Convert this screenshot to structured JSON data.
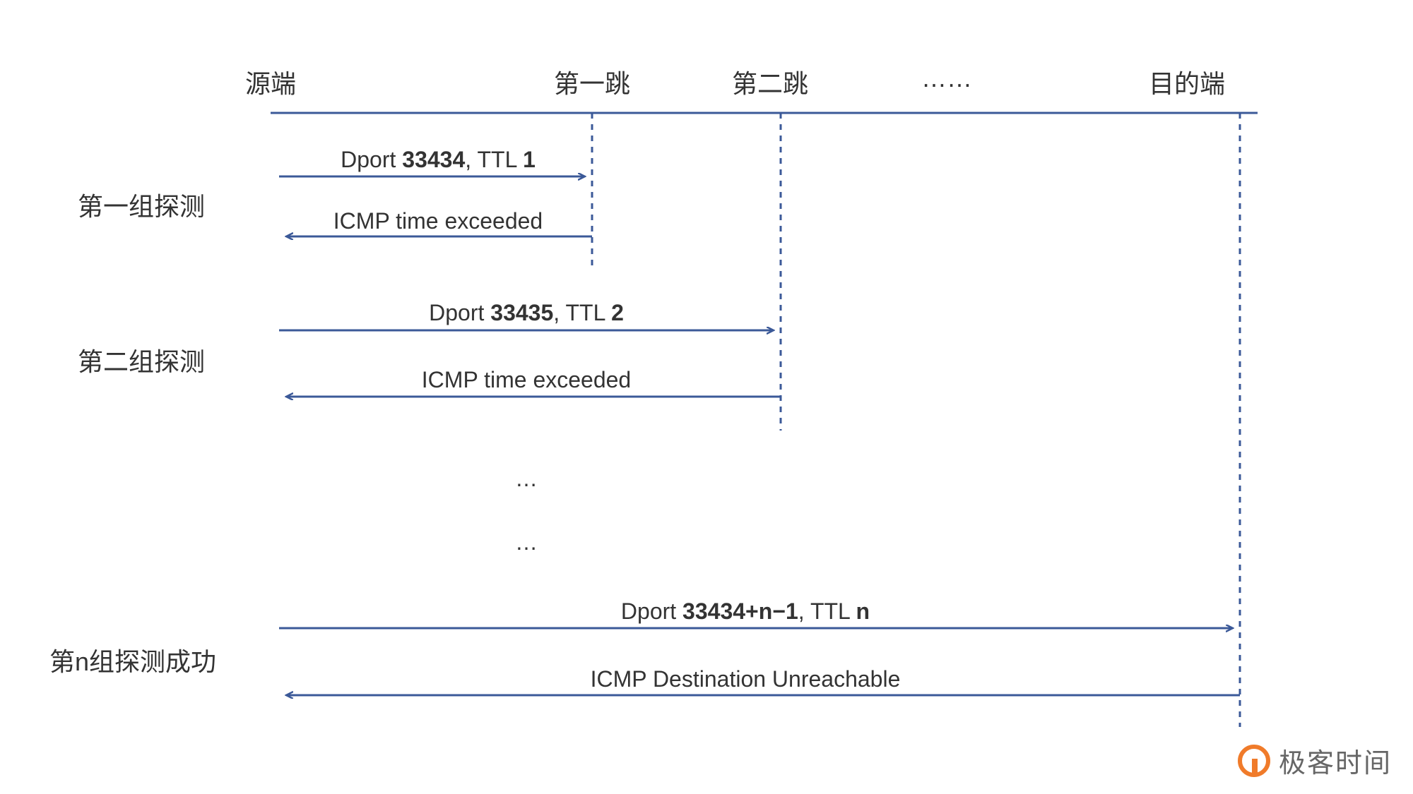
{
  "colors": {
    "line": "#3b5998",
    "text": "#333333"
  },
  "columns": {
    "source": "源端",
    "hop1": "第一跳",
    "hop2": "第二跳",
    "dots": "……",
    "dest": "目的端"
  },
  "groups": {
    "g1": "第一组探测",
    "g2": "第二组探测",
    "gn": "第n组探测成功"
  },
  "messages": {
    "g1_send_pre": "Dport ",
    "g1_send_port": "33434",
    "g1_send_mid": ", TTL ",
    "g1_send_ttl": "1",
    "g1_reply": "ICMP time exceeded",
    "g2_send_pre": "Dport ",
    "g2_send_port": "33435",
    "g2_send_mid": ", TTL ",
    "g2_send_ttl": "2",
    "g2_reply": "ICMP time exceeded",
    "gn_send_pre": "Dport ",
    "gn_send_port": "33434+n−1",
    "gn_send_mid": ", TTL ",
    "gn_send_ttl": "n",
    "gn_reply": "ICMP Destination Unreachable"
  },
  "ellipsis": "…",
  "watermark": "极客时间",
  "chart_data": {
    "type": "sequence",
    "participants": [
      "源端",
      "第一跳",
      "第二跳",
      "……",
      "目的端"
    ],
    "groups": [
      {
        "name": "第一组探测",
        "messages": [
          {
            "from": "源端",
            "to": "第一跳",
            "text": "Dport 33434, TTL 1"
          },
          {
            "from": "第一跳",
            "to": "源端",
            "text": "ICMP time exceeded"
          }
        ]
      },
      {
        "name": "第二组探测",
        "messages": [
          {
            "from": "源端",
            "to": "第二跳",
            "text": "Dport 33435, TTL 2"
          },
          {
            "from": "第二跳",
            "to": "源端",
            "text": "ICMP time exceeded"
          }
        ]
      },
      {
        "name": "第n组探测成功",
        "messages": [
          {
            "from": "源端",
            "to": "目的端",
            "text": "Dport 33434+n−1, TTL n"
          },
          {
            "from": "目的端",
            "to": "源端",
            "text": "ICMP Destination Unreachable"
          }
        ]
      }
    ]
  }
}
